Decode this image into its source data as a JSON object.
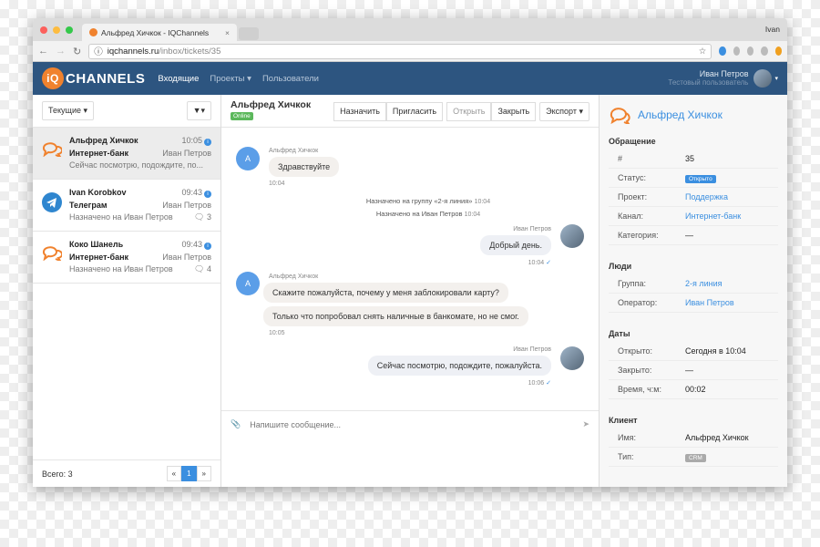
{
  "browser": {
    "tab_title": "Альфред Хичкок - IQChannels",
    "os_user": "Ivan",
    "url_host": "iqchannels.ru",
    "url_path": "/inbox/tickets/35"
  },
  "navbar": {
    "logo_iq": "iQ",
    "logo_text": "CHANNELS",
    "links": [
      "Входящие",
      "Проекты",
      "Пользователи"
    ],
    "user_name": "Иван Петров",
    "user_role": "Тестовый пользователь"
  },
  "left": {
    "filter_label": "Текущие",
    "total": "Всего: 3",
    "page": "1",
    "prev": "«",
    "next": "»",
    "conversations": [
      {
        "name": "Альфред Хичкок",
        "time": "10:05",
        "channel": "Интернет-банк",
        "operator": "Иван Петров",
        "preview": "Сейчас посмотрю, подождите, по...",
        "count": "",
        "icon": "chat-icon"
      },
      {
        "name": "Ivan Korobkov",
        "time": "09:43",
        "channel": "Телеграм",
        "operator": "Иван Петров",
        "preview": "Назначено на Иван Петров",
        "count": "3",
        "icon": "telegram-icon"
      },
      {
        "name": "Коко Шанель",
        "time": "09:43",
        "channel": "Интернет-банк",
        "operator": "Иван Петров",
        "preview": "Назначено на Иван Петров",
        "count": "4",
        "icon": "chat-icon"
      }
    ]
  },
  "chat": {
    "title": "Альфред Хичкок",
    "status": "Online",
    "actions": {
      "assign": "Назначить",
      "invite": "Пригласить",
      "open": "Открыть",
      "close": "Закрыть",
      "export": "Экспорт"
    },
    "client_initial": "А",
    "client_name": "Альфред Хичкок",
    "operator_name": "Иван Петров",
    "m1": "Здравствуйте",
    "m1_time": "10:04",
    "sys1": "Назначено на группу «2-я линия»",
    "sys1_time": "10:04",
    "sys2": "Назначено на Иван Петров",
    "sys2_time": "10:04",
    "m2": "Добрый день.",
    "m2_time": "10:04",
    "m3": "Скажите пожалуйста, почему у меня заблокировали карту?",
    "m4": "Только что попробовал снять наличные в банкомате, но не смог.",
    "m4_time": "10:05",
    "m5": "Сейчас посмотрю, подождите, пожалуйста.",
    "m5_time": "10:06",
    "placeholder": "Напишите сообщение..."
  },
  "details": {
    "name": "Альфред Хичкок",
    "ticket_title": "Обращение",
    "id_label": "#",
    "id": "35",
    "status_label": "Статус:",
    "status": "Открыто",
    "project_label": "Проект:",
    "project": "Поддержка",
    "channel_label": "Канал:",
    "channel": "Интернет-банк",
    "category_label": "Категория:",
    "category": "—",
    "people_title": "Люди",
    "group_label": "Группа:",
    "group": "2-я линия",
    "operator_label": "Оператор:",
    "operator": "Иван Петров",
    "dates_title": "Даты",
    "opened_label": "Открыто:",
    "opened": "Сегодня в 10:04",
    "closed_label": "Закрыто:",
    "closed": "—",
    "time_label": "Время, ч:м:",
    "time": "00:02",
    "client_title": "Клиент",
    "cname_label": "Имя:",
    "cname": "Альфред Хичкок",
    "type_label": "Тип:",
    "type": "CRM"
  },
  "colors": {
    "navbar": "#2d5580",
    "accent": "#3b8fe0",
    "brand": "#f0822e",
    "online": "#5cb85c"
  }
}
